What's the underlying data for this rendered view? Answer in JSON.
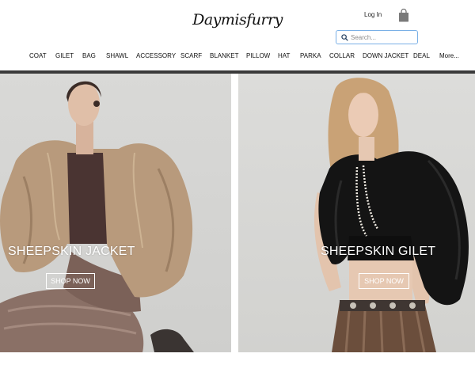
{
  "header": {
    "logo": "Daymisfurry",
    "login_label": "Log In",
    "cart_icon": "shopping-bag-icon",
    "search": {
      "placeholder": "Search...",
      "value": "",
      "icon": "search-icon"
    }
  },
  "nav": {
    "items": [
      "COAT",
      "GILET",
      "BAG",
      "SHAWL",
      "ACCESSORY",
      "SCARF",
      "BLANKET",
      "PILLOW",
      "HAT",
      "PARKA",
      "COLLAR",
      "DOWN JACKET",
      "DEAL",
      "More..."
    ]
  },
  "hero": [
    {
      "title": "SHEEPSKIN JACKET",
      "button": "SHOP NOW"
    },
    {
      "title": "SHEEPSKIN GILET",
      "button": "SHOP NOW"
    }
  ],
  "colors": {
    "search_border": "#7ab0e6",
    "divider": "#3a3a3a",
    "overlay_text": "#ffffff"
  }
}
